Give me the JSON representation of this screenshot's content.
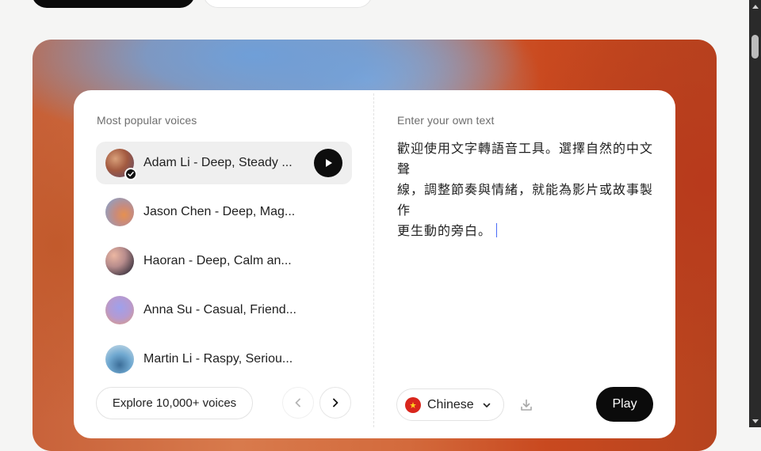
{
  "colors": {
    "accent_dark": "#0b0b0b",
    "hero_blue": "#6f9fd8",
    "hero_orange": "#c8623a",
    "caret": "#4a6cf7"
  },
  "voices_panel": {
    "label": "Most popular voices",
    "voices": [
      {
        "name": "Adam Li - Deep, Steady ...",
        "selected": true,
        "avatar_icon": "gradient-avatar"
      },
      {
        "name": "Jason Chen - Deep, Mag...",
        "selected": false,
        "avatar_icon": "gradient-avatar"
      },
      {
        "name": "Haoran - Deep, Calm an...",
        "selected": false,
        "avatar_icon": "gradient-avatar"
      },
      {
        "name": "Anna Su - Casual, Friend...",
        "selected": false,
        "avatar_icon": "gradient-avatar"
      },
      {
        "name": "Martin Li - Raspy, Seriou...",
        "selected": false,
        "avatar_icon": "gradient-avatar"
      }
    ],
    "explore_label": "Explore 10,000+ voices",
    "prev_icon": "chevron-left-icon",
    "next_icon": "chevron-right-icon"
  },
  "text_panel": {
    "label": "Enter your own text",
    "lines": [
      "歡迎使用文字轉語音工具。選擇自然的中文聲",
      "線，調整節奏與情緒，就能為影片或故事製作",
      "更生動的旁白。"
    ],
    "language": {
      "label": "Chinese",
      "flag_icon": "china-flag-icon"
    },
    "download_icon": "download-icon",
    "play_label": "Play"
  }
}
